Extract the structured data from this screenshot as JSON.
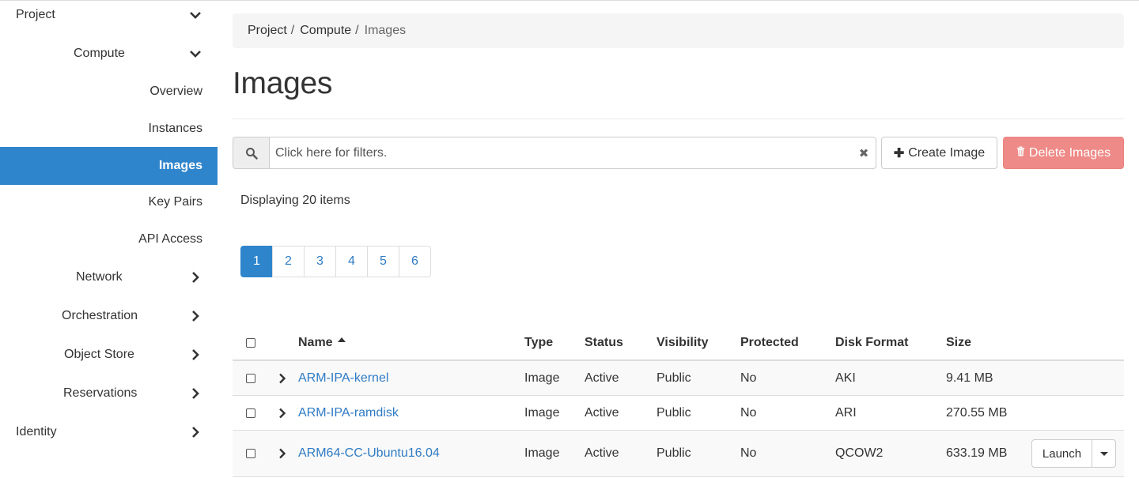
{
  "sidebar": {
    "items": [
      {
        "label": "Project",
        "chevron": "down"
      },
      {
        "label": "Compute",
        "chevron": "down"
      },
      {
        "label": "Overview"
      },
      {
        "label": "Instances"
      },
      {
        "label": "Images",
        "active": true
      },
      {
        "label": "Key Pairs"
      },
      {
        "label": "API Access"
      },
      {
        "label": "Network",
        "chevron": "right"
      },
      {
        "label": "Orchestration",
        "chevron": "right"
      },
      {
        "label": "Object Store",
        "chevron": "right"
      },
      {
        "label": "Reservations",
        "chevron": "right"
      },
      {
        "label": "Identity",
        "chevron": "right"
      }
    ]
  },
  "breadcrumb": [
    "Project",
    "Compute",
    "Images"
  ],
  "page_title": "Images",
  "filter": {
    "placeholder": "Click here for filters.",
    "icon": "search-icon",
    "clear_icon": "close-icon"
  },
  "actions": {
    "create": "Create Image",
    "create_icon": "plus-icon",
    "delete": "Delete Images",
    "delete_icon": "trash-icon",
    "delete_color": "#ee8a87"
  },
  "item_count": "Displaying 20 items",
  "pagination": {
    "pages": [
      "1",
      "2",
      "3",
      "4",
      "5",
      "6"
    ],
    "current": "1"
  },
  "table": {
    "headers": {
      "name": "Name",
      "type": "Type",
      "status": "Status",
      "visibility": "Visibility",
      "protected": "Protected",
      "disk_format": "Disk Format",
      "size": "Size"
    },
    "rows": [
      {
        "name": "ARM-IPA-kernel",
        "type": "Image",
        "status": "Active",
        "visibility": "Public",
        "protected": "No",
        "disk_format": "AKI",
        "size": "9.41 MB"
      },
      {
        "name": "ARM-IPA-ramdisk",
        "type": "Image",
        "status": "Active",
        "visibility": "Public",
        "protected": "No",
        "disk_format": "ARI",
        "size": "270.55 MB"
      },
      {
        "name": "ARM64-CC-Ubuntu16.04",
        "type": "Image",
        "status": "Active",
        "visibility": "Public",
        "protected": "No",
        "disk_format": "QCOW2",
        "size": "633.19 MB",
        "action": "Launch"
      }
    ]
  },
  "colors": {
    "accent": "#2f85cc",
    "link": "#2f7bc4"
  }
}
